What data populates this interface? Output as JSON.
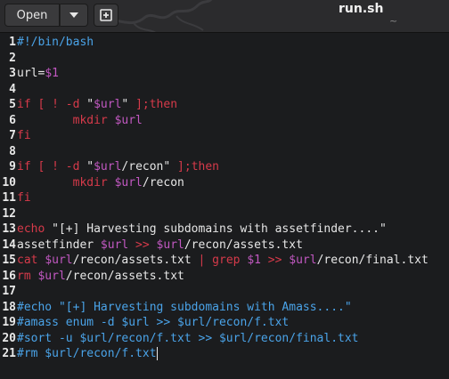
{
  "header": {
    "open_label": "Open",
    "filename": "run.sh",
    "subtitle": "~"
  },
  "icons": {
    "dropdown": "chevron-down-icon",
    "new_doc": "new-document-icon"
  },
  "lines": [
    {
      "n": "1",
      "segs": [
        {
          "t": "#!/bin/bash",
          "c": "cmt"
        }
      ]
    },
    {
      "n": "2",
      "segs": []
    },
    {
      "n": "3",
      "segs": [
        {
          "t": "url=",
          "c": ""
        },
        {
          "t": "$1",
          "c": "var"
        }
      ]
    },
    {
      "n": "4",
      "segs": []
    },
    {
      "n": "5",
      "segs": [
        {
          "t": "if [ ! -d ",
          "c": "kw"
        },
        {
          "t": "\"",
          "c": "str"
        },
        {
          "t": "$url",
          "c": "var"
        },
        {
          "t": "\"",
          "c": "str"
        },
        {
          "t": " ];then",
          "c": "kw"
        }
      ]
    },
    {
      "n": "6",
      "segs": [
        {
          "t": "        mkdir ",
          "c": "kw"
        },
        {
          "t": "$url",
          "c": "var"
        }
      ]
    },
    {
      "n": "7",
      "segs": [
        {
          "t": "fi",
          "c": "kw"
        }
      ]
    },
    {
      "n": "8",
      "segs": []
    },
    {
      "n": "9",
      "segs": [
        {
          "t": "if [ ! -d ",
          "c": "kw"
        },
        {
          "t": "\"",
          "c": "str"
        },
        {
          "t": "$url",
          "c": "var"
        },
        {
          "t": "/recon\"",
          "c": "str"
        },
        {
          "t": " ];then",
          "c": "kw"
        }
      ]
    },
    {
      "n": "10",
      "segs": [
        {
          "t": "        mkdir ",
          "c": "kw"
        },
        {
          "t": "$url",
          "c": "var"
        },
        {
          "t": "/recon",
          "c": ""
        }
      ]
    },
    {
      "n": "11",
      "segs": [
        {
          "t": "fi",
          "c": "kw"
        }
      ]
    },
    {
      "n": "12",
      "segs": []
    },
    {
      "n": "13",
      "segs": [
        {
          "t": "echo ",
          "c": "kw"
        },
        {
          "t": "\"[+] Harvesting subdomains with assetfinder....\"",
          "c": "str"
        }
      ]
    },
    {
      "n": "14",
      "segs": [
        {
          "t": "assetfinder ",
          "c": ""
        },
        {
          "t": "$url",
          "c": "var"
        },
        {
          "t": " >> ",
          "c": "kw"
        },
        {
          "t": "$url",
          "c": "var"
        },
        {
          "t": "/recon/assets.txt",
          "c": ""
        }
      ]
    },
    {
      "n": "15",
      "segs": [
        {
          "t": "cat ",
          "c": "kw"
        },
        {
          "t": "$url",
          "c": "var"
        },
        {
          "t": "/recon/assets.txt ",
          "c": ""
        },
        {
          "t": "| grep ",
          "c": "kw"
        },
        {
          "t": "$1",
          "c": "var"
        },
        {
          "t": " >> ",
          "c": "kw"
        },
        {
          "t": "$url",
          "c": "var"
        },
        {
          "t": "/recon/final.txt",
          "c": ""
        }
      ]
    },
    {
      "n": "16",
      "segs": [
        {
          "t": "rm ",
          "c": "kw"
        },
        {
          "t": "$url",
          "c": "var"
        },
        {
          "t": "/recon/assets.txt",
          "c": ""
        }
      ]
    },
    {
      "n": "17",
      "segs": []
    },
    {
      "n": "18",
      "segs": [
        {
          "t": "#echo \"[+] Harvesting subdomains with Amass....\"",
          "c": "cmt"
        }
      ]
    },
    {
      "n": "19",
      "segs": [
        {
          "t": "#amass enum -d $url >> $url/recon/f.txt",
          "c": "cmt"
        }
      ]
    },
    {
      "n": "20",
      "segs": [
        {
          "t": "#sort -u $url/recon/f.txt >> $url/recon/final.txt",
          "c": "cmt"
        }
      ]
    },
    {
      "n": "21",
      "segs": [
        {
          "t": "#rm $url/recon/f.txt",
          "c": "cmt"
        }
      ]
    }
  ]
}
